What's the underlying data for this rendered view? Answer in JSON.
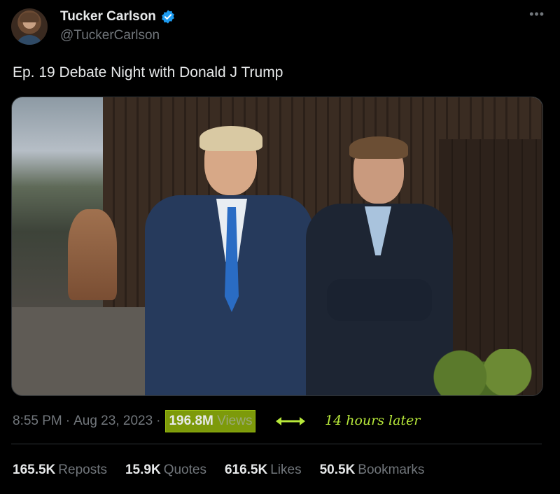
{
  "author": {
    "display_name": "Tucker Carlson",
    "handle": "@TuckerCarlson",
    "verified_icon": "verified-badge-icon",
    "accent_color": "#1d9bf0"
  },
  "more_icon": "•••",
  "tweet": {
    "text": "Ep. 19  Debate Night with Donald J Trump"
  },
  "meta": {
    "time": "8:55 PM",
    "date": "Aug 23, 2023",
    "views_count": "196.8M",
    "views_label": "Views",
    "highlight_color": "#7d9a0a"
  },
  "annotation": {
    "text": "14 hours later",
    "color": "#b7e83a"
  },
  "stats": [
    {
      "count": "165.5K",
      "label": "Reposts"
    },
    {
      "count": "15.9K",
      "label": "Quotes"
    },
    {
      "count": "616.5K",
      "label": "Likes"
    },
    {
      "count": "50.5K",
      "label": "Bookmarks"
    }
  ]
}
